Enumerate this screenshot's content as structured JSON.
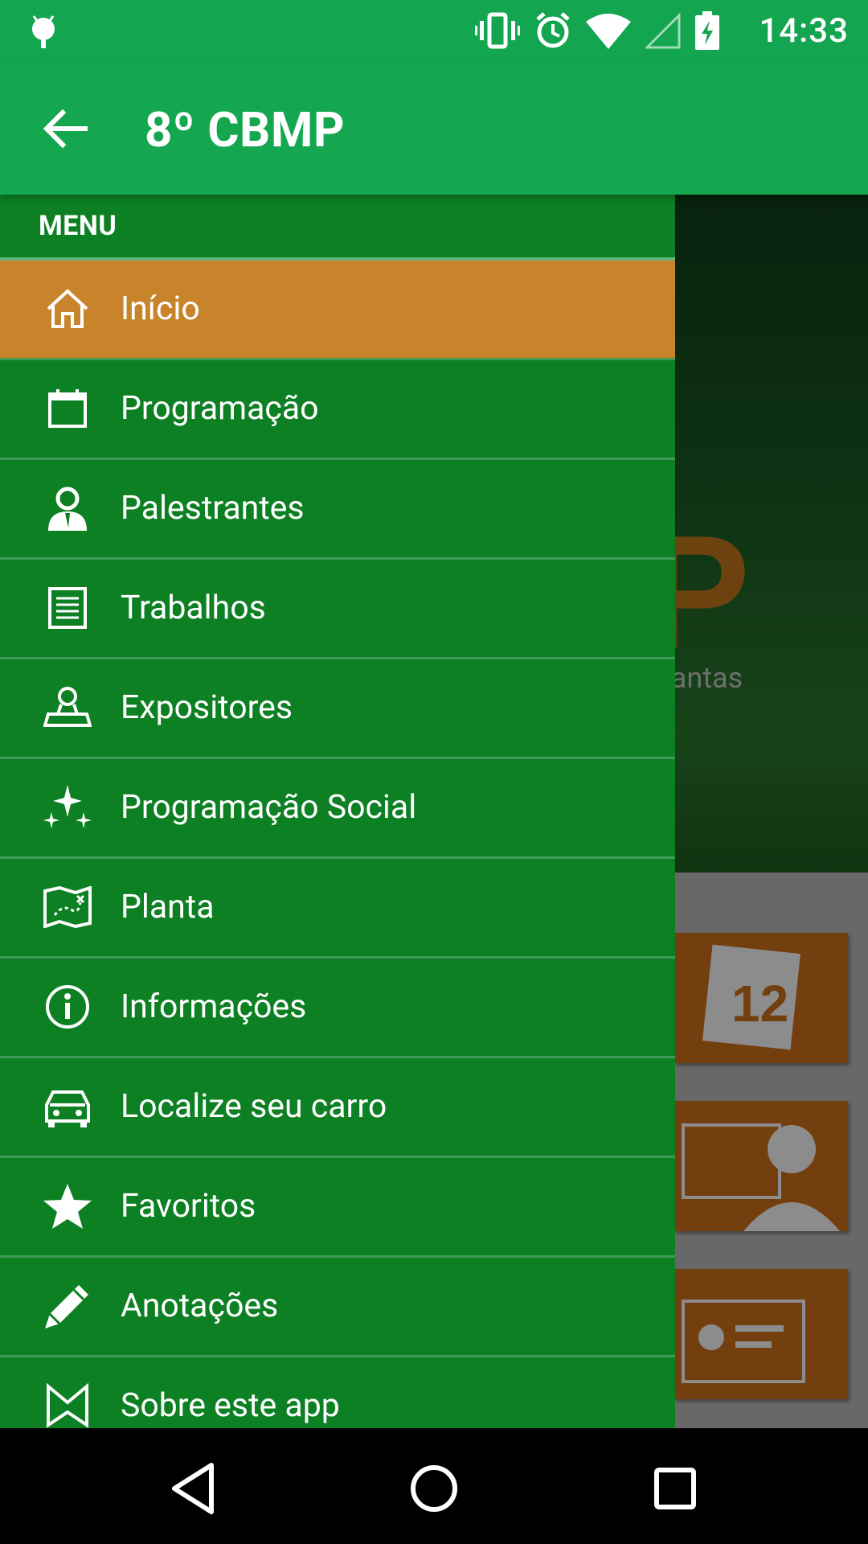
{
  "status_bar": {
    "time": "14:33"
  },
  "app_bar": {
    "title": "8º CBMP"
  },
  "background": {
    "hero_letter": "P",
    "hero_sub": "lantas",
    "tile_calendar_number": "12"
  },
  "drawer": {
    "header": "MENU",
    "items": [
      {
        "label": "Início",
        "icon": "home-icon",
        "active": true
      },
      {
        "label": "Programação",
        "icon": "calendar-icon"
      },
      {
        "label": "Palestrantes",
        "icon": "speaker-icon"
      },
      {
        "label": "Trabalhos",
        "icon": "document-icon"
      },
      {
        "label": "Expositores",
        "icon": "stamp-icon"
      },
      {
        "label": "Programação Social",
        "icon": "sparkle-icon"
      },
      {
        "label": "Planta",
        "icon": "map-icon"
      },
      {
        "label": "Informações",
        "icon": "info-icon"
      },
      {
        "label": "Localize seu carro",
        "icon": "car-icon"
      },
      {
        "label": "Favoritos",
        "icon": "star-icon"
      },
      {
        "label": "Anotações",
        "icon": "pencil-icon"
      },
      {
        "label": "Sobre este app",
        "icon": "about-icon"
      }
    ]
  },
  "colors": {
    "primary": "#15a750",
    "drawer_bg": "#0c8023",
    "active_item": "#c8842a",
    "tile_orange": "#d4741c"
  }
}
